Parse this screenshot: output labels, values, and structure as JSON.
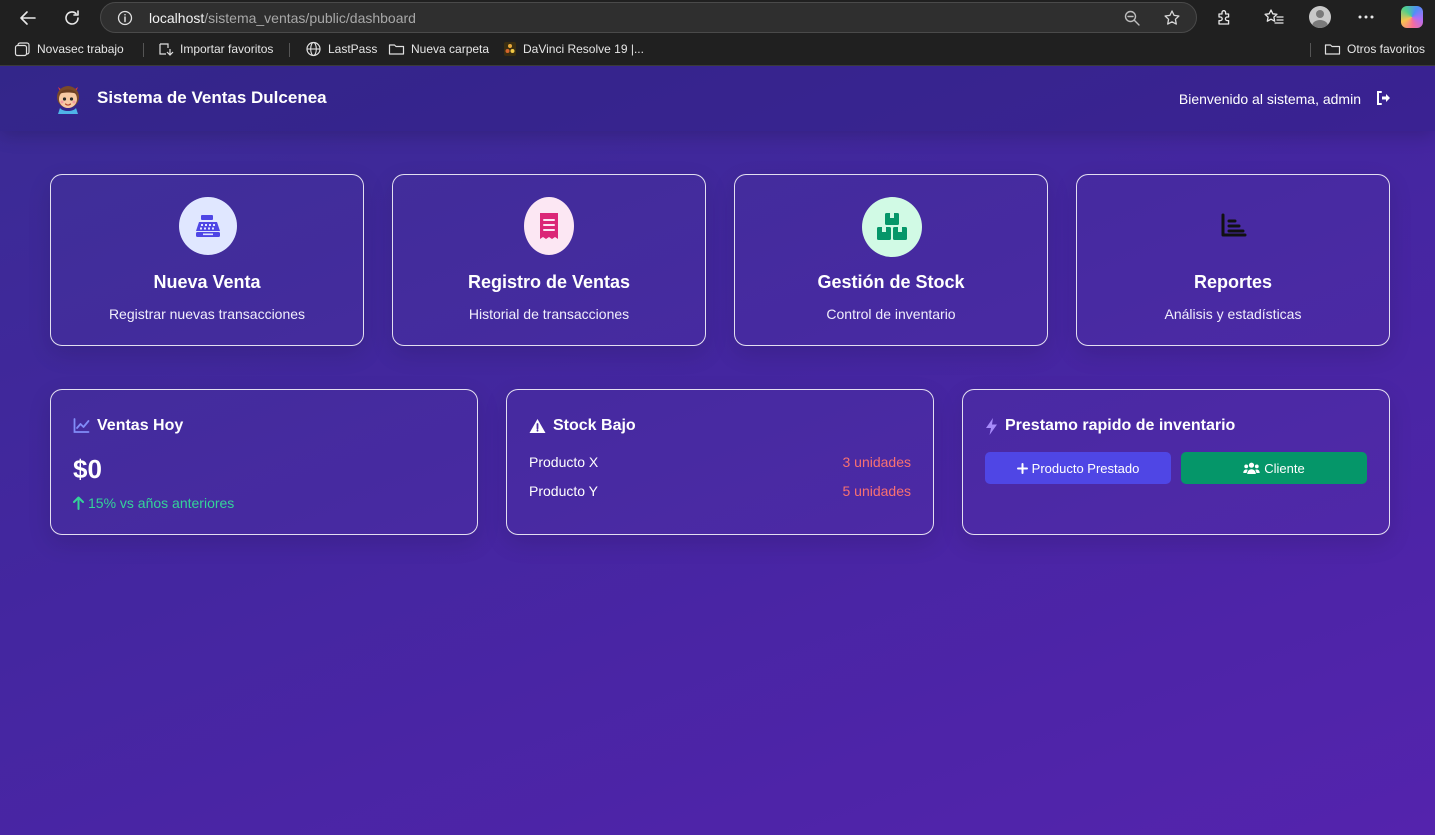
{
  "browser": {
    "url_host": "localhost",
    "url_path": "/sistema_ventas/public/dashboard",
    "bookmarks": [
      "Novasec trabajo",
      "Importar favoritos",
      "LastPass",
      "Nueva carpeta",
      "DaVinci Resolve 19 |..."
    ],
    "other_bookmarks": "Otros favoritos"
  },
  "header": {
    "title": "Sistema de Ventas Dulcenea",
    "welcome": "Bienvenido al sistema, admin"
  },
  "actions": [
    {
      "title": "Nueva Venta",
      "subtitle": "Registrar nuevas transacciones",
      "icon": "cash-register-icon",
      "color": "#4f46e5"
    },
    {
      "title": "Registro de Ventas",
      "subtitle": "Historial de transacciones",
      "icon": "receipt-icon",
      "color": "#db2777"
    },
    {
      "title": "Gestión de Stock",
      "subtitle": "Control de inventario",
      "icon": "boxes-icon",
      "color": "#059669"
    },
    {
      "title": "Reportes",
      "subtitle": "Análisis y estadísticas",
      "icon": "chart-bar-icon",
      "color": "#111111"
    }
  ],
  "sales_today": {
    "title": "Ventas Hoy",
    "amount": "$0",
    "growth": "15% vs años anteriores",
    "growth_color": "#34d399"
  },
  "low_stock": {
    "title": "Stock Bajo",
    "items": [
      {
        "name": "Producto X",
        "qty": "3 unidades"
      },
      {
        "name": "Producto Y",
        "qty": "5 unidades"
      }
    ],
    "qty_color": "#f87171"
  },
  "quick_loan": {
    "title": "Prestamo rapido de inventario",
    "btn_product": "Producto Prestado",
    "btn_client": "Cliente",
    "btn_product_color": "#4f46e5",
    "btn_client_color": "#059669"
  }
}
